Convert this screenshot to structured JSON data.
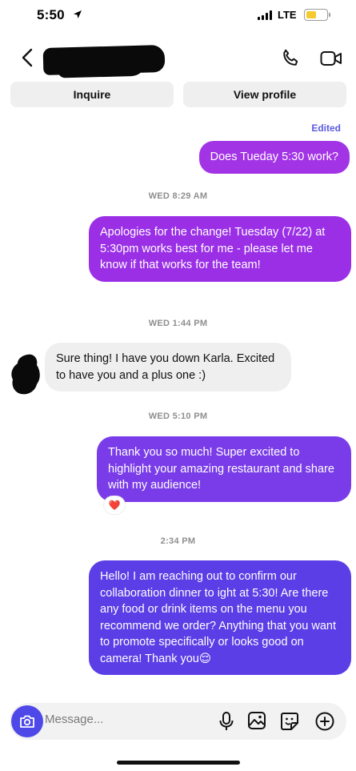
{
  "status": {
    "time": "5:50",
    "network": "LTE",
    "battery_color": "#f6c92e",
    "icons": [
      "location-arrow-icon",
      "signal-icon",
      "battery-icon"
    ]
  },
  "header": {
    "icons": [
      "back-chevron-icon",
      "phone-icon",
      "video-camera-icon"
    ]
  },
  "actions": {
    "inquire": "Inquire",
    "view_profile": "View profile"
  },
  "thread": {
    "edited_label": "Edited",
    "messages": [
      {
        "from": "me",
        "text": "Does Tueday 5:30 work?"
      },
      {
        "timestamp": "WED 8:29 AM"
      },
      {
        "from": "me",
        "text": "Apologies for the change! Tuesday (7/22) at 5:30pm works best for me - please let me know if that works for the team!"
      },
      {
        "timestamp": "WED 1:44 PM"
      },
      {
        "from": "them",
        "text": "Sure thing! I have you down Karla. Excited to have you and a plus one :)"
      },
      {
        "timestamp": "WED 5:10 PM"
      },
      {
        "from": "me",
        "text": "Thank you so much! Super excited to highlight your amazing restaurant and share with my audience!",
        "reaction": "❤️"
      },
      {
        "timestamp": "2:34 PM"
      },
      {
        "from": "me",
        "text": "Hello! I am reaching out to confirm our collaboration dinner to ight at 5:30! Are there any food or drink items on the menu you recommend we order? Anything that you want to promote specifically or looks good on camera! Thank you😌"
      }
    ]
  },
  "composer": {
    "placeholder": "Message...",
    "icons": [
      "camera-icon",
      "microphone-icon",
      "gallery-icon",
      "sticker-icon",
      "plus-icon"
    ]
  },
  "colors": {
    "bubble_1": "#a334e6",
    "bubble_2": "#9a2fe6",
    "bubble_3": "#7a3ce8",
    "bubble_4": "#5b3ee6",
    "incoming": "#efefef",
    "accent": "#4e48e8"
  }
}
